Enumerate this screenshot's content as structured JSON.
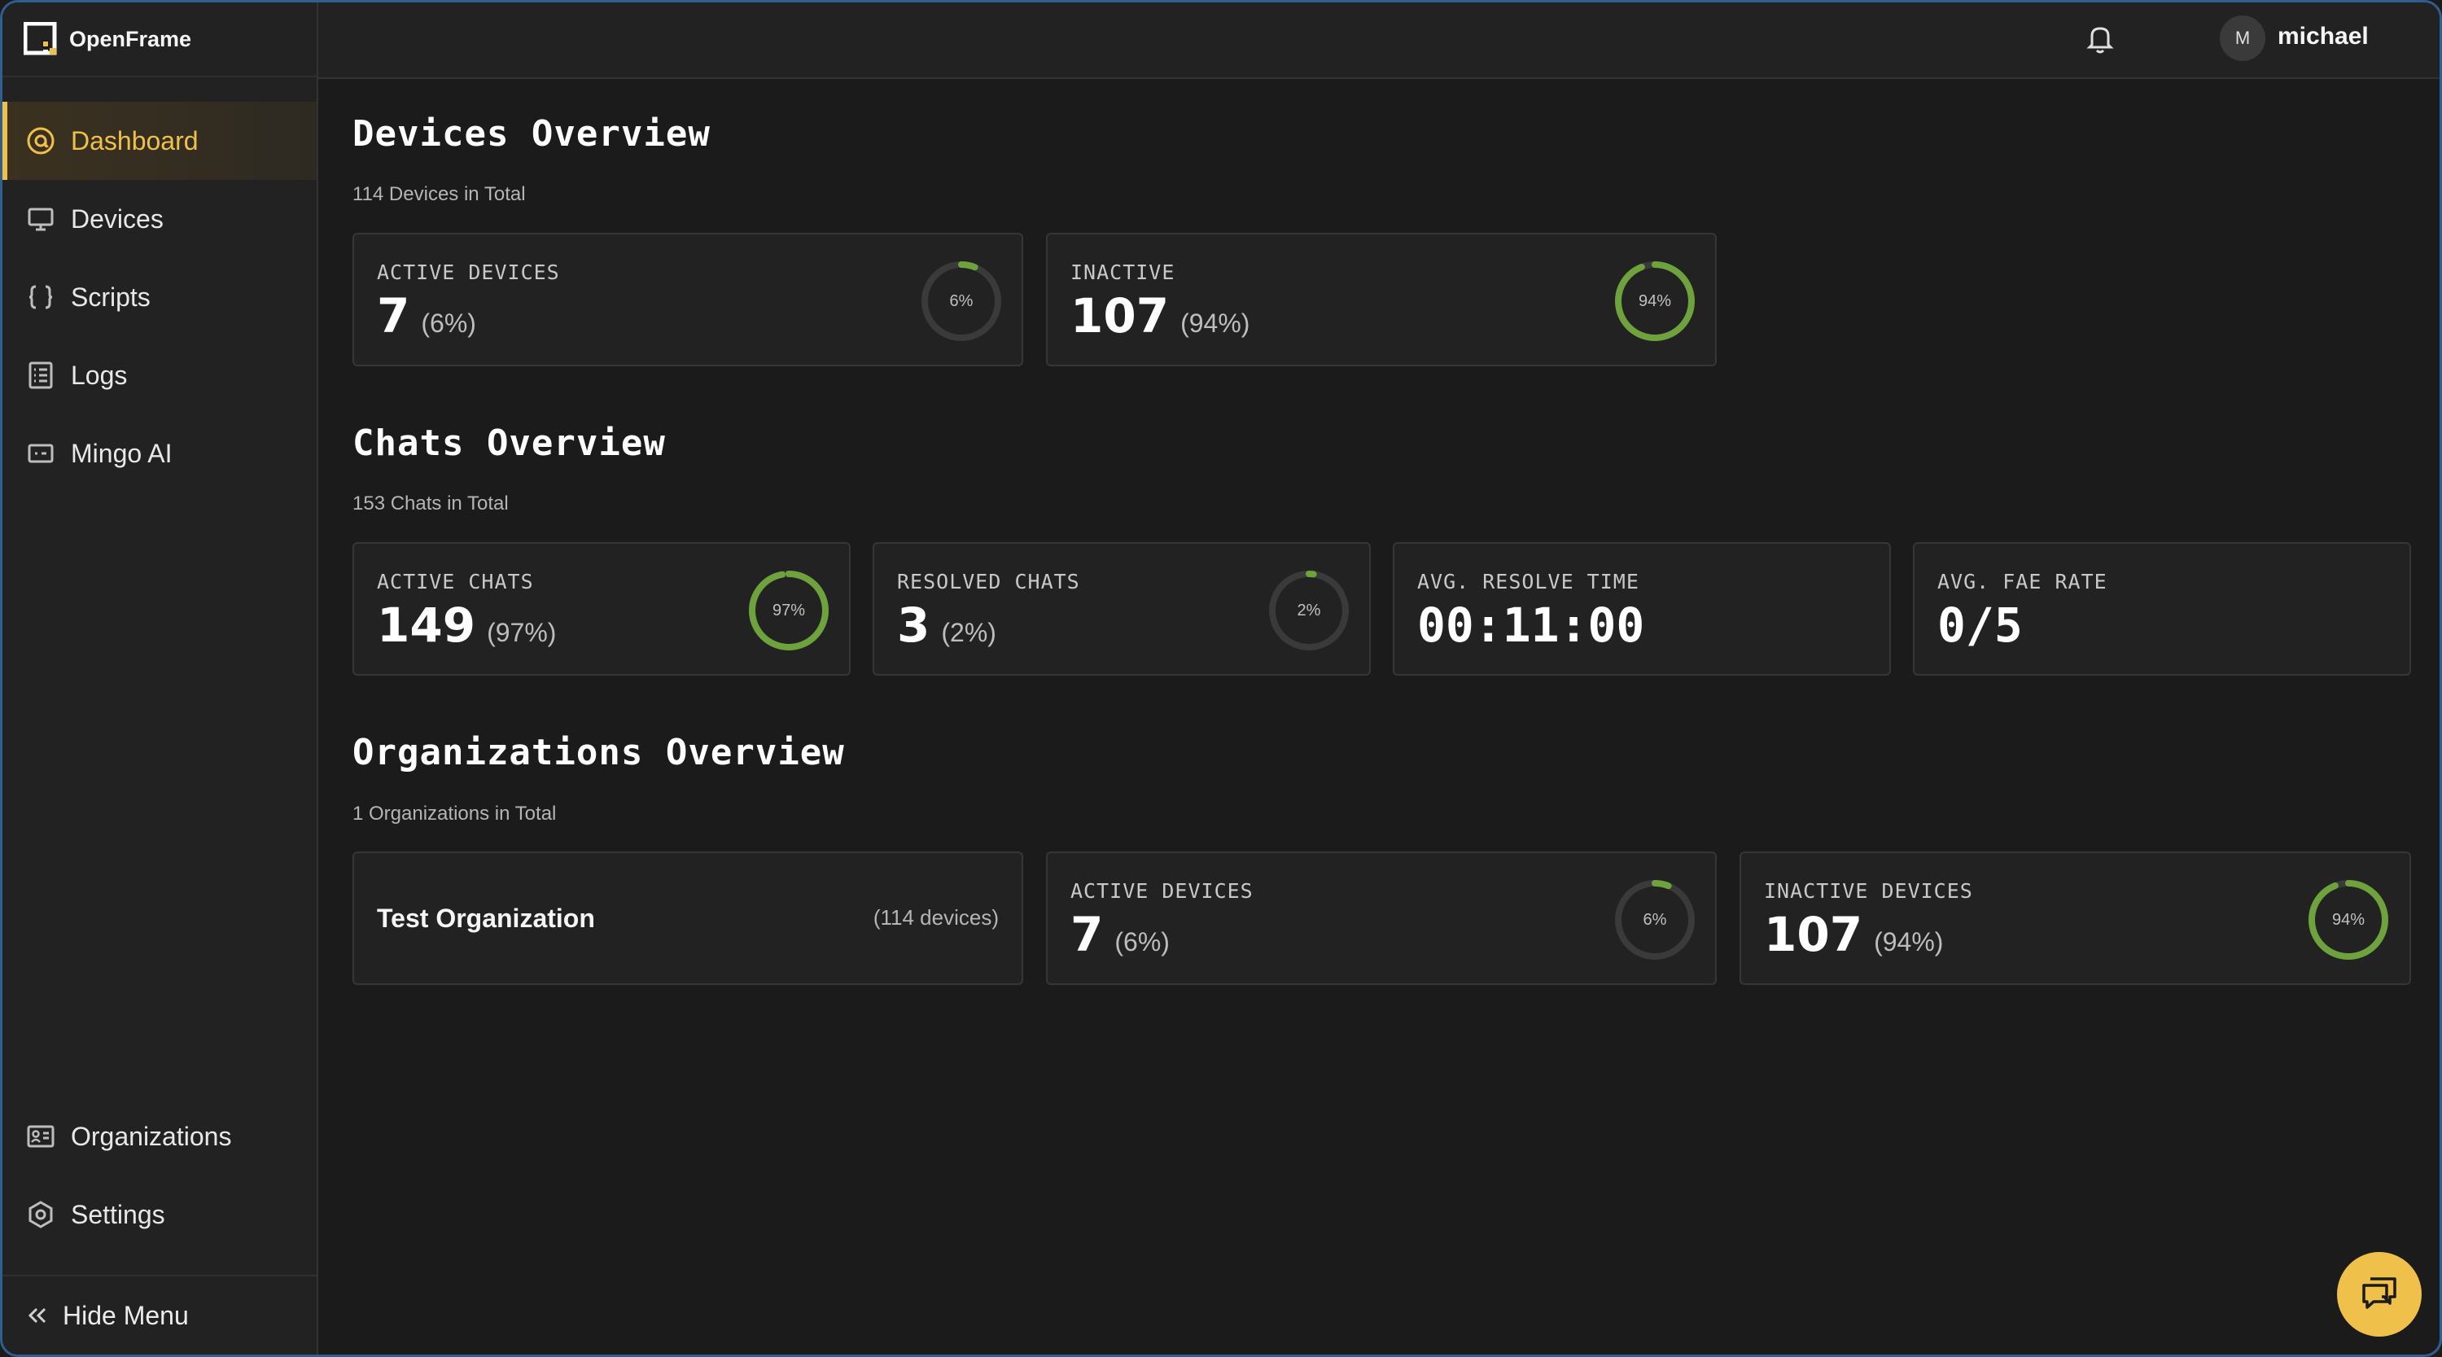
{
  "app": {
    "name": "OpenFrame"
  },
  "sidebar": {
    "items": [
      {
        "label": "Dashboard",
        "icon": "dashboard-icon",
        "active": true
      },
      {
        "label": "Devices",
        "icon": "monitor-icon"
      },
      {
        "label": "Scripts",
        "icon": "braces-icon"
      },
      {
        "label": "Logs",
        "icon": "logs-icon"
      },
      {
        "label": "Mingo AI",
        "icon": "ai-chat-icon"
      }
    ],
    "bottom_items": [
      {
        "label": "Organizations",
        "icon": "id-card-icon"
      },
      {
        "label": "Settings",
        "icon": "gear-icon"
      }
    ],
    "hide_menu": "Hide Menu"
  },
  "header": {
    "user_initial": "M",
    "username": "michael"
  },
  "devices_overview": {
    "title": "Devices Overview",
    "subtitle": "114 Devices in Total",
    "cards": [
      {
        "label": "ACTIVE DEVICES",
        "value": "7",
        "pct": "(6%)",
        "ring_label": "6%",
        "ring_fraction": 0.06
      },
      {
        "label": "INACTIVE",
        "value": "107",
        "pct": "(94%)",
        "ring_label": "94%",
        "ring_fraction": 0.94
      }
    ]
  },
  "chats_overview": {
    "title": "Chats Overview",
    "subtitle": "153 Chats in Total",
    "cards": [
      {
        "label": "ACTIVE CHATS",
        "value": "149",
        "pct": "(97%)",
        "ring_label": "97%",
        "ring_fraction": 0.97
      },
      {
        "label": "RESOLVED CHATS",
        "value": "3",
        "pct": "(2%)",
        "ring_label": "2%",
        "ring_fraction": 0.02
      },
      {
        "label": "AVG. RESOLVE TIME",
        "value": "00:11:00"
      },
      {
        "label": "AVG. FAE RATE",
        "value": "0/5"
      }
    ]
  },
  "orgs_overview": {
    "title": "Organizations Overview",
    "subtitle": "1 Organizations in Total",
    "org": {
      "name": "Test Organization",
      "devices": "(114 devices)"
    },
    "cards": [
      {
        "label": "ACTIVE DEVICES",
        "value": "7",
        "pct": "(6%)",
        "ring_label": "6%",
        "ring_fraction": 0.06
      },
      {
        "label": "INACTIVE DEVICES",
        "value": "107",
        "pct": "(94%)",
        "ring_label": "94%",
        "ring_fraction": 0.94
      }
    ]
  },
  "colors": {
    "accent": "#f0c14a",
    "ring_fill": "#6ea23c",
    "ring_track": "#3a3a3a"
  }
}
